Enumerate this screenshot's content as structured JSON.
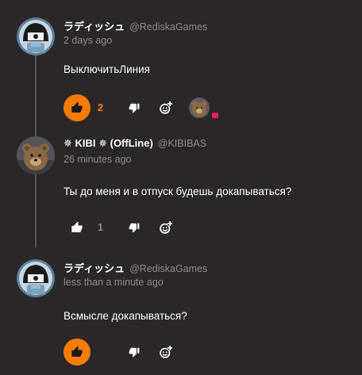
{
  "comments": [
    {
      "username": "ラディッシュ",
      "handle": "@RediskaGames",
      "timestamp": "2 days ago",
      "text": "ВыключитьЛиния",
      "like_count": "2",
      "liked": true,
      "avatar_icon": "hooded-character-icon"
    },
    {
      "username": "✵ KIBI ✵  (OffLine)",
      "handle": "@KIBIBAS",
      "timestamp": "26 minutes ago",
      "text": "Ты до меня и в отпуск будешь докапываться?",
      "like_count": "1",
      "liked": false,
      "avatar_icon": "teddy-bear-icon"
    },
    {
      "username": "ラディッシュ",
      "handle": "@RediskaGames",
      "timestamp": "less than a minute ago",
      "text": "Всмысле докапываться?",
      "like_count": "",
      "liked": true,
      "avatar_icon": "hooded-character-icon"
    }
  ],
  "colors": {
    "background": "#2b2729",
    "accent": "#f57c00",
    "muted": "#8f8b8c",
    "badge": "#e91e63"
  }
}
